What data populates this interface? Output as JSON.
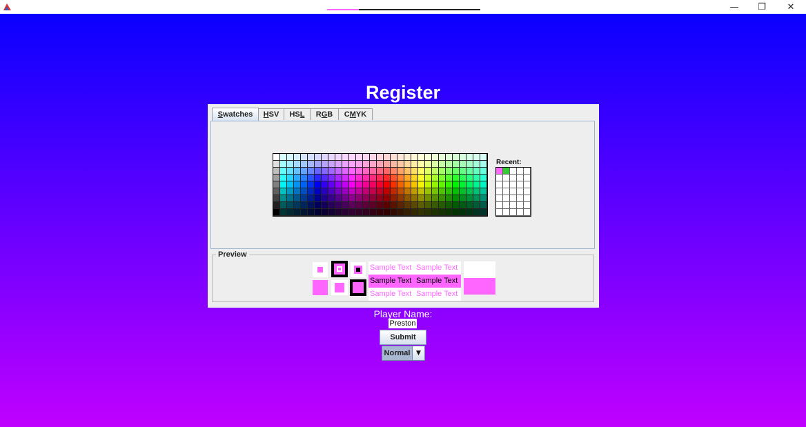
{
  "window": {
    "minimize_icon": "minimize-icon",
    "maximize_icon": "restore-icon",
    "close_icon": "close-icon",
    "minimize_glyph": "—",
    "restore_glyph": "❐",
    "close_glyph": "✕"
  },
  "page": {
    "title": "Register"
  },
  "chooser": {
    "tabs": [
      {
        "pre": "",
        "mnemonic": "S",
        "post": "watches"
      },
      {
        "pre": "",
        "mnemonic": "H",
        "post": "SV"
      },
      {
        "pre": "HS",
        "mnemonic": "L",
        "post": ""
      },
      {
        "pre": "R",
        "mnemonic": "G",
        "post": "B"
      },
      {
        "pre": "C",
        "mnemonic": "M",
        "post": "YK"
      }
    ],
    "active_tab": 0,
    "recent_label": "Recent:",
    "recent_colors": [
      "#ff66ff",
      "#33cc33"
    ],
    "preview_label": "Preview",
    "sample_text": "Sample Text",
    "selected_color": "#ff66ff"
  },
  "form": {
    "player_label": "Player Name:",
    "player_value": "Preston",
    "submit_label": "Submit",
    "mode_value": "Normal",
    "mode_arrow": "▼"
  },
  "colors": {
    "gradient_top": "#0a00ff",
    "gradient_bottom": "#c000ff",
    "panel": "#eeeeee"
  }
}
